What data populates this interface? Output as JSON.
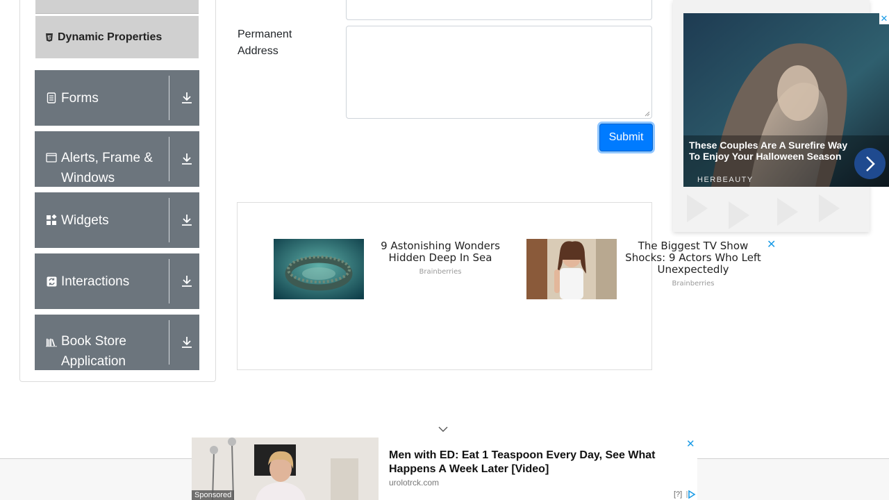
{
  "sidebar": {
    "active_sub_item": {
      "label": "Dynamic Properties",
      "icon": "html5-icon"
    },
    "groups": [
      {
        "title": "Forms",
        "icon": "document-icon",
        "action_icon": "download-arrow-icon"
      },
      {
        "title": "Alerts, Frame & Windows",
        "icon": "window-icon",
        "action_icon": "download-arrow-icon"
      },
      {
        "title": "Widgets",
        "icon": "widgets-icon",
        "action_icon": "download-arrow-icon"
      },
      {
        "title": "Interactions",
        "icon": "interactions-icon",
        "action_icon": "download-arrow-icon"
      },
      {
        "title": "Book Store Application",
        "icon": "books-icon",
        "action_icon": "download-arrow-icon"
      }
    ]
  },
  "form": {
    "permanent_address_label": "Permanent Address",
    "permanent_address_value": "",
    "submit_label": "Submit"
  },
  "native_ads": {
    "cards": [
      {
        "title": "9 Astonishing Wonders Hidden Deep In Sea",
        "source": "Brainberries"
      },
      {
        "title": "The Biggest TV Show Shocks: 9 Actors Who Left Unexpectedly",
        "source": "Brainberries"
      }
    ],
    "close_glyph": "✕"
  },
  "right_ad": {
    "caption": "These Couples Are A Surefire Way To Enjoy Your Halloween Season",
    "brand": "HERBEAUTY",
    "close_glyph": "✕"
  },
  "sponsored": {
    "tag": "Sponsored",
    "title": "Men with ED: Eat 1 Teaspoon Every Day, See What Happens A Week Later [Video]",
    "source": "urolotrck.com",
    "help": "[?]",
    "close_glyph": "✕"
  },
  "colors": {
    "sidebar_group_bg": "#6c757d",
    "sub_item_bg": "#d0d0d0",
    "primary": "#007bff",
    "ad_close": "#1a9be6",
    "ad_next_bg": "#1f4a8f"
  }
}
